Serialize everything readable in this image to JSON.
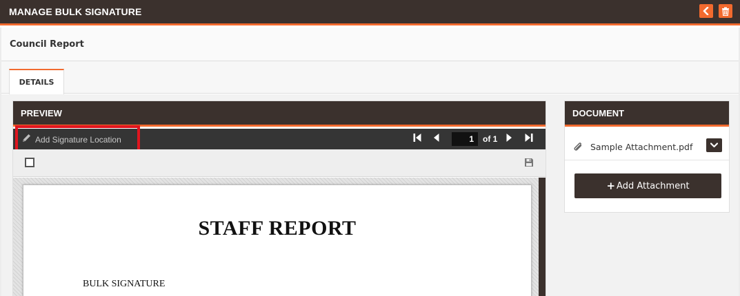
{
  "header": {
    "title": "MANAGE BULK SIGNATURE",
    "back_icon": "chevron-left-icon",
    "delete_icon": "trash-icon",
    "accent_color": "#f26a2e",
    "bar_color": "#3b312d"
  },
  "record": {
    "title": "Council Report"
  },
  "tabs": [
    {
      "label": "DETAILS",
      "active": true
    }
  ],
  "preview": {
    "title": "PREVIEW",
    "add_signature_label": "Add Signature Location",
    "current_page": "1",
    "page_of": "of 1",
    "document": {
      "title": "STAFF REPORT",
      "line1": "BULK SIGNATURE"
    }
  },
  "document_panel": {
    "title": "DOCUMENT",
    "attachments": [
      {
        "name": "Sample Attachment.pdf"
      }
    ],
    "add_attachment_label": "Add Attachment",
    "add_attachment_plus": "+"
  }
}
